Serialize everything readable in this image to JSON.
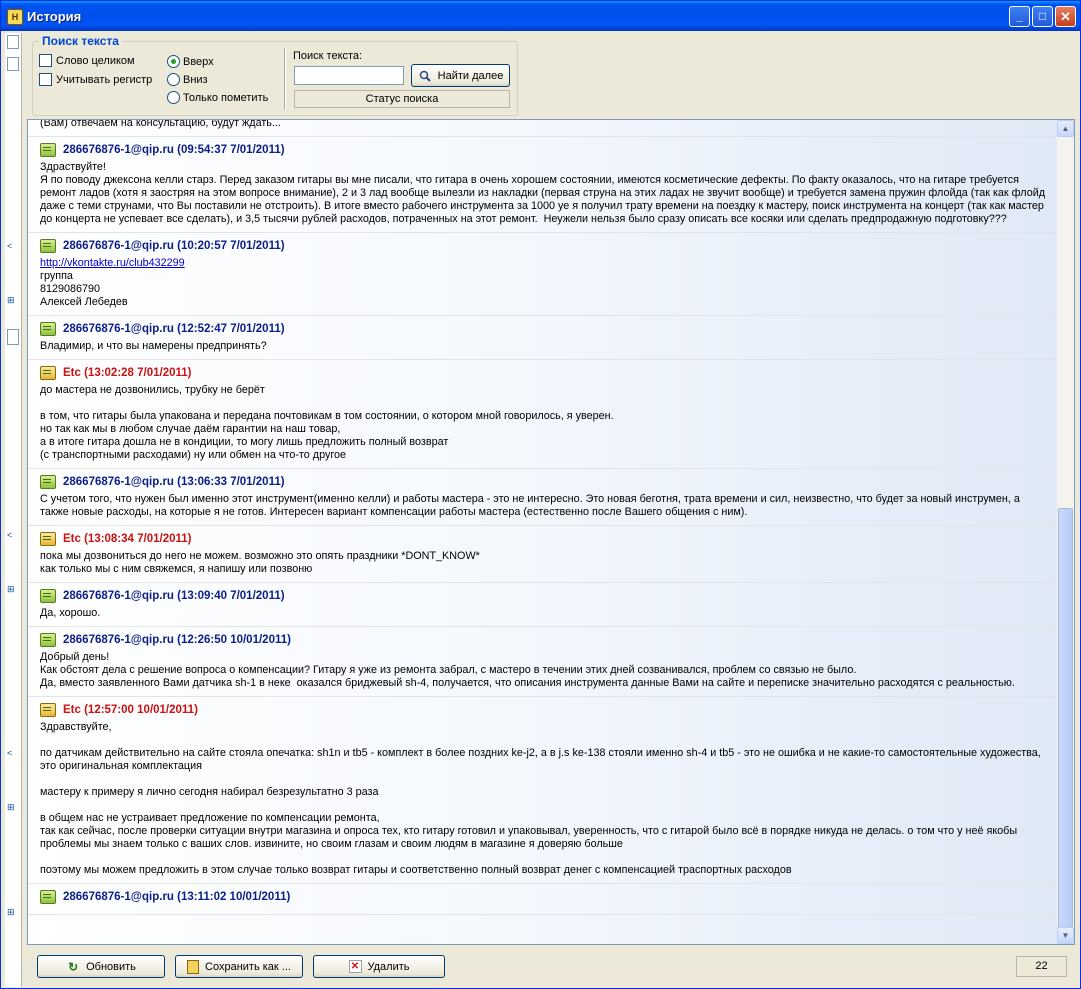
{
  "window": {
    "title": "История"
  },
  "search_group": {
    "title": "Поиск текста",
    "whole_word": "Слово целиком",
    "match_case": "Учитывать регистр",
    "dir_up": "Вверх",
    "dir_down": "Вниз",
    "only_mark": "Только пометить",
    "search_label": "Поиск текста:",
    "search_value": "",
    "find_next": "Найти далее",
    "status": "Статус поиска"
  },
  "messages": [
    {
      "type": "out",
      "header": "",
      "lines": [
        "(Вам) отвечаем на консультацию, будут ждать..."
      ]
    },
    {
      "type": "in",
      "header": "286676876-1@qip.ru (09:54:37 7/01/2011)",
      "lines": [
        "Здраствуйте!",
        "Я по поводу джексона келли старз. Перед заказом гитары вы мне писали, что гитара в очень хорошем состоянии, имеются косметические дефекты. По факту оказалось, что на гитаре требуется ремонт ладов (хотя я заостряя на этом вопросе внимание), 2 и 3 лад вообще вылезли из накладки (первая струна на этих ладах не звучит вообще) и требуется замена пружин флойда (так как флойд даже с теми струнами, что Вы поставили не отстроить). В итоге вместо рабочего инструмента за 1000 уе я получил трату времени на поездку к мастеру, поиск инструмента на концерт (так как мастер до концерта не успевает все сделать), и 3,5 тысячи рублей расходов, потраченных на этот ремонт.  Неужели нельзя было сразу описать все косяки или сделать предпродажную подготовку???"
      ]
    },
    {
      "type": "in",
      "header": "286676876-1@qip.ru (10:20:57 7/01/2011)",
      "link": "http://vkontakte.ru/club432299",
      "lines": [
        "группа",
        "8129086790",
        "Алексей Лебедев"
      ]
    },
    {
      "type": "in",
      "header": "286676876-1@qip.ru (12:52:47 7/01/2011)",
      "lines": [
        "Владимир, и что вы намерены предпринять?"
      ]
    },
    {
      "type": "out",
      "header": "Etc (13:02:28 7/01/2011)",
      "lines": [
        "до мастера не дозвонились, трубку не берёт",
        "",
        "в том, что гитары была упакована и передана почтовикам в том состоянии, о котором мной говорилось, я уверен.",
        "но так как мы в любом случае даём гарантии на наш товар,",
        "а в итоге гитара дошла не в кондиции, то могу лишь предложить полный возврат",
        "(с транспортными расходами) ну или обмен на что-то другое"
      ]
    },
    {
      "type": "in",
      "header": "286676876-1@qip.ru (13:06:33 7/01/2011)",
      "lines": [
        "С учетом того, что нужен был именно этот инструмент(именно келли) и работы мастера - это не интересно. Это новая беготня, трата времени и сил, неизвестно, что будет за новый инструмен, а также новые расходы, на которые я не готов. Интересен вариант компенсации работы мастера (естественно после Вашего общения с ним)."
      ]
    },
    {
      "type": "out",
      "header": "Etc (13:08:34 7/01/2011)",
      "lines": [
        "пока мы дозвониться до него не можем. возможно это опять праздники *DONT_KNOW*",
        "как только мы с ним свяжемся, я напишу или позвоню"
      ]
    },
    {
      "type": "in",
      "header": "286676876-1@qip.ru (13:09:40 7/01/2011)",
      "lines": [
        "Да, хорошо."
      ]
    },
    {
      "type": "in",
      "header": "286676876-1@qip.ru (12:26:50 10/01/2011)",
      "lines": [
        "Добрый день!",
        "Как обстоят дела с решение вопроса о компенсации? Гитару я уже из ремонта забрал, с мастеро в течении этих дней созванивался, проблем со связью не было.",
        "Да, вместо заявленного Вами датчика sh-1 в неке  оказался бриджевый sh-4, получается, что описания инструмента данные Вами на сайте и переписке значительно расходятся с реальностью."
      ]
    },
    {
      "type": "out",
      "header": "Etc (12:57:00 10/01/2011)",
      "lines": [
        "Здравствуйте,",
        "",
        "по датчикам действительно на сайте стояла опечатка: sh1n и tb5 - комплект в более поздних ke-j2, а в j.s ke-138 стояли именно sh-4 и tb5 - это не ошибка и не какие-то самостоятельные художества, это оригинальная комплектация",
        "",
        "мастеру к примеру я лично сегодня набирал безрезультатно 3 раза",
        "",
        "в общем нас не устраивает предложение по компенсации ремонта,",
        "так как сейчас, после проверки ситуации внутри магазина и опроса тех, кто гитару готовил и упаковывал, уверенность, что с гитарой было всё в порядке никуда не делась. о том что у неё якобы проблемы мы знаем только с ваших слов. извините, но своим глазам и своим людям в магазине я доверяю больше",
        "",
        "поэтому мы можем предложить в этом случае только возврат гитары и соответственно полный возврат денег с компенсацией траспортных расходов"
      ]
    },
    {
      "type": "in",
      "header": "286676876-1@qip.ru (13:11:02 10/01/2011)",
      "lines": []
    }
  ],
  "buttons": {
    "refresh": "Обновить",
    "save_as": "Сохранить как ...",
    "delete": "Удалить"
  },
  "count": "22"
}
